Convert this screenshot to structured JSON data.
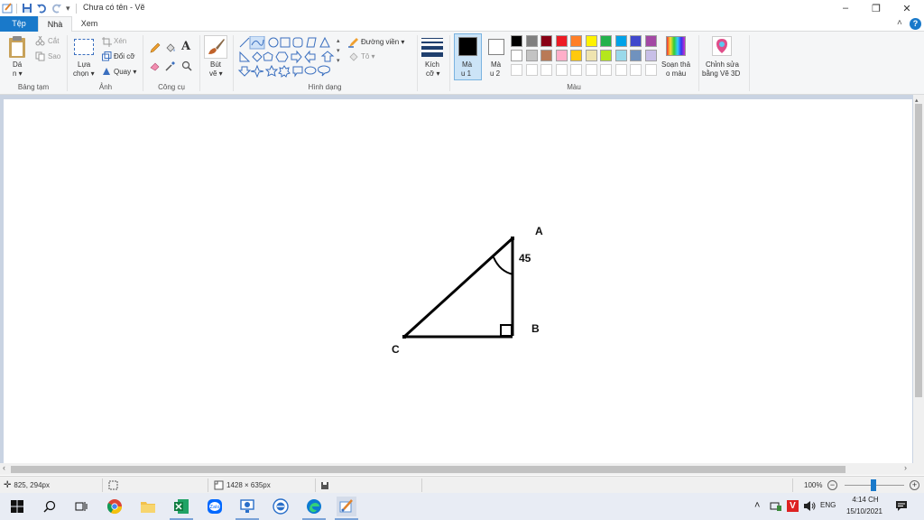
{
  "window": {
    "title": "Chưa có tên - Vẽ",
    "minimize": "–",
    "restore": "❐",
    "close": "✕",
    "ribbon_collapse": "˄",
    "help": "?"
  },
  "tabs": [
    {
      "label": "Tệp"
    },
    {
      "label": "Nhà"
    },
    {
      "label": "Xem"
    }
  ],
  "ribbon": {
    "clipboard": {
      "paste_label_1": "Dá",
      "paste_label_2": "n ▾",
      "cut": "Cắt",
      "copy": "Sao",
      "group": "Bảng tạm"
    },
    "image": {
      "select_1": "Lựa",
      "select_2": "chọn ▾",
      "crop": "Xén",
      "resize": "Đổi cỡ",
      "rotate": "Quay ▾",
      "group": "Ảnh"
    },
    "tools": {
      "text_icon": "A",
      "group": "Công cụ"
    },
    "brushes": {
      "label_1": "Bút",
      "label_2": "vẽ ▾"
    },
    "shapes": {
      "outline": "Đường viền ▾",
      "fill": "Tô ▾",
      "group": "Hình dạng"
    },
    "size": {
      "label_1": "Kích",
      "label_2": "cỡ ▾"
    },
    "colors": {
      "color1_1": "Mà",
      "color1_2": "u 1",
      "color2_1": "Mà",
      "color2_2": "u 2",
      "edit_1": "Soạn thả",
      "edit_2": "o màu",
      "paint3d_1": "Chỉnh sửa",
      "paint3d_2": "bằng Vẽ 3D",
      "group": "Màu",
      "color1_value": "#000000",
      "color2_value": "#ffffff",
      "palette_row1": [
        "#000000",
        "#7f7f7f",
        "#880015",
        "#ed1c24",
        "#ff7f27",
        "#fff200",
        "#22b14c",
        "#00a2e8",
        "#3f48cc",
        "#a349a4"
      ],
      "palette_row2": [
        "#ffffff",
        "#c3c3c3",
        "#b97a57",
        "#ffaec9",
        "#ffc90e",
        "#efe4b0",
        "#b5e61d",
        "#99d9ea",
        "#7092be",
        "#c8bfe7"
      ]
    }
  },
  "drawing": {
    "label_a": "A",
    "label_b": "B",
    "label_c": "C",
    "angle_label": "45"
  },
  "statusbar": {
    "cursor_pos": "825, 294px",
    "canvas_size": "1428 × 635px",
    "zoom": "100%"
  },
  "taskbar": {
    "lang": "ENG",
    "time": "4:14 CH",
    "date": "15/10/2021"
  }
}
